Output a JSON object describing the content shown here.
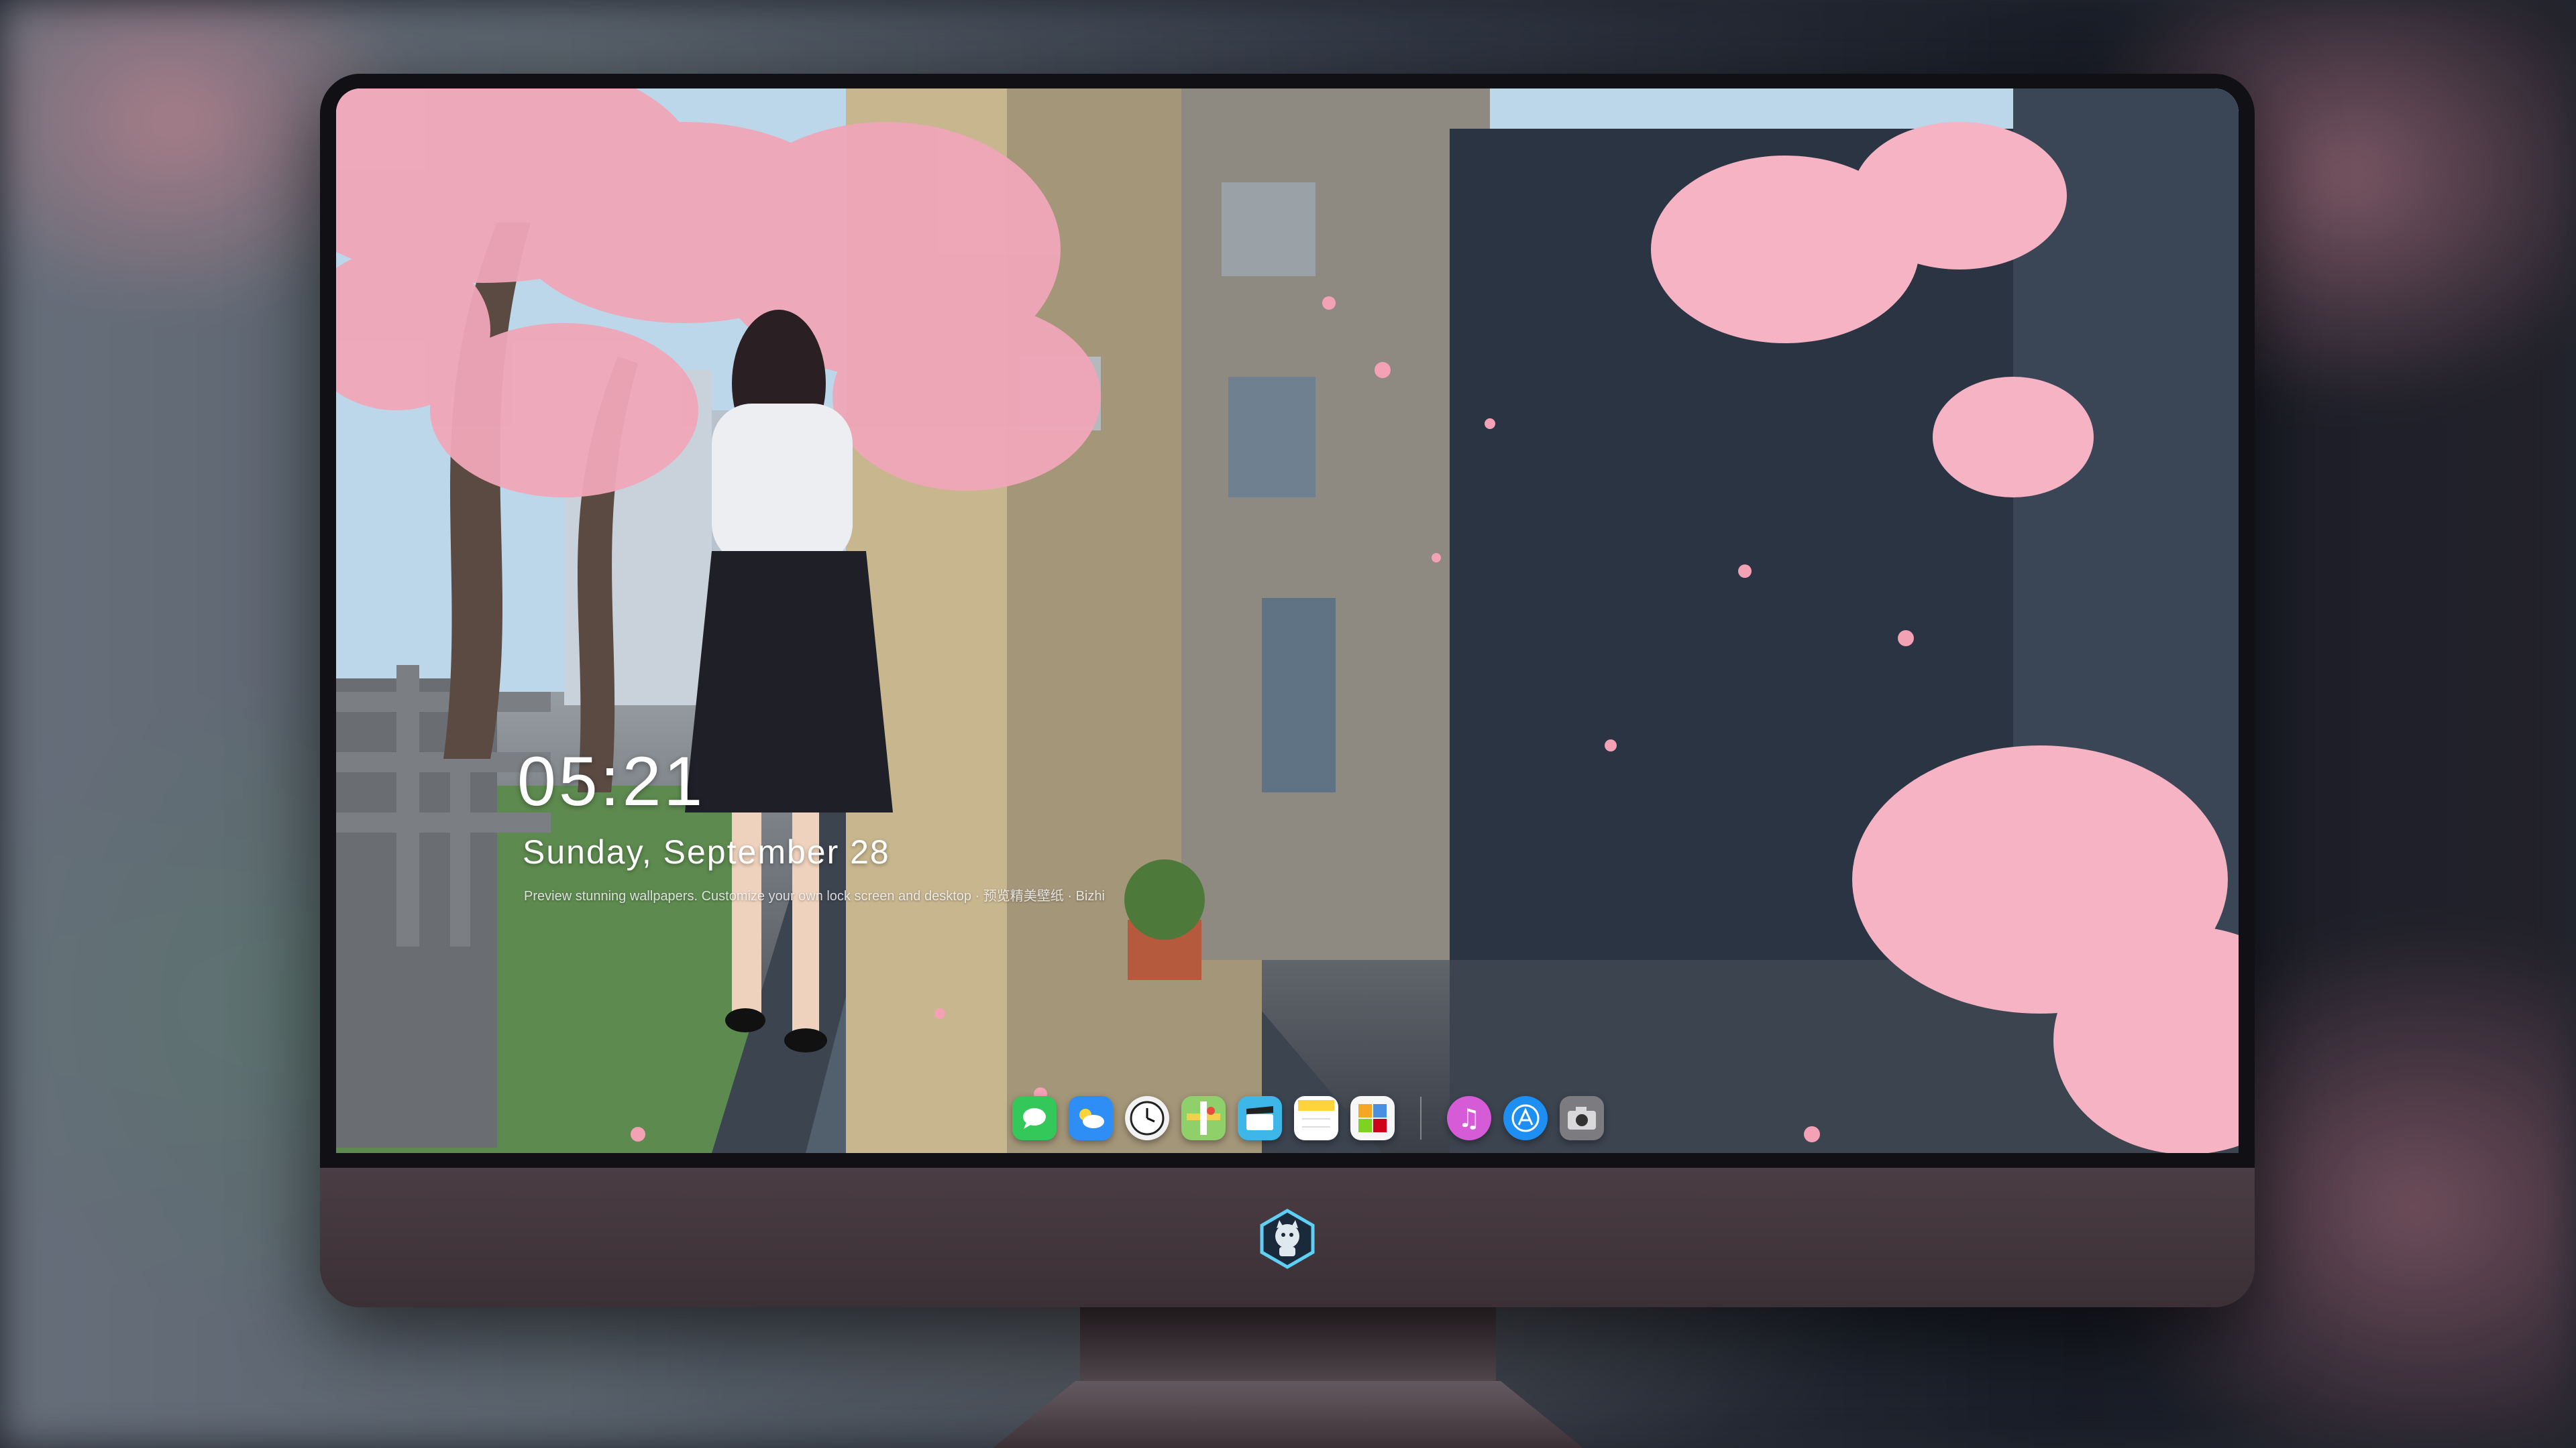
{
  "lock_screen": {
    "time": "05:21",
    "date": "Sunday, September  28",
    "hint": "Preview stunning wallpapers. Customize your own lock screen and desktop · 预览精美壁纸 · Bizhi"
  },
  "dock": {
    "apps": [
      {
        "name": "Messages",
        "icon": "messages-icon",
        "color": "#34c759"
      },
      {
        "name": "Weather",
        "icon": "weather-icon",
        "color": "#2f8ef5"
      },
      {
        "name": "Clock",
        "icon": "clock-icon",
        "color": "#f2f2f2"
      },
      {
        "name": "Maps",
        "icon": "maps-icon",
        "color": "#8fd06b"
      },
      {
        "name": "Clips",
        "icon": "clips-icon",
        "color": "#3fb6e8"
      },
      {
        "name": "Notes",
        "icon": "notes-icon",
        "color": "#ffd43b"
      },
      {
        "name": "Photos",
        "icon": "photos-icon",
        "color": "#f7f7f7"
      },
      {
        "name": "iTunes",
        "icon": "music-icon",
        "color": "#d55bd7"
      },
      {
        "name": "App Store",
        "icon": "app-store-icon",
        "color": "#1d8ff3"
      },
      {
        "name": "Camera",
        "icon": "camera-icon",
        "color": "#7c7c80"
      }
    ]
  },
  "colors": {
    "blossom": "#f2a9bb",
    "monitor_chin": "#3b3036",
    "bezel": "#111115"
  }
}
